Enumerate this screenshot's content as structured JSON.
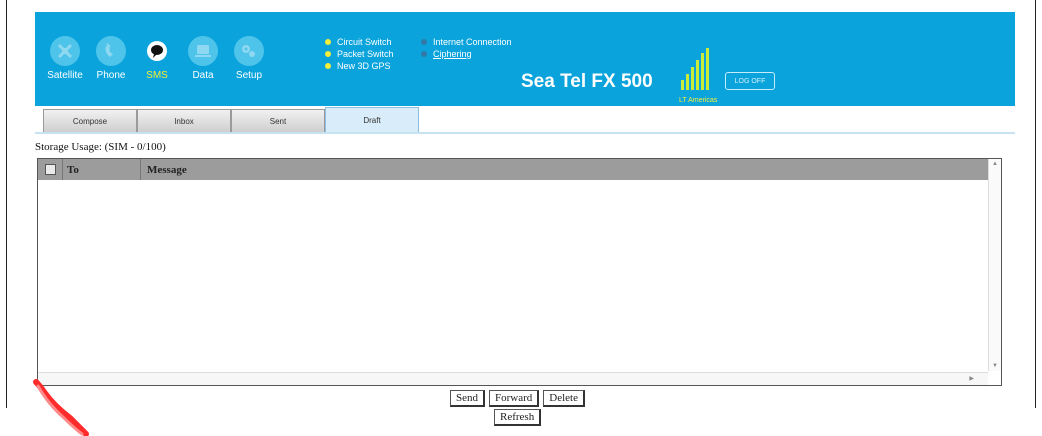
{
  "header": {
    "nav": [
      {
        "label": "Satellite",
        "icon": "satellite-icon"
      },
      {
        "label": "Phone",
        "icon": "phone-icon"
      },
      {
        "label": "SMS",
        "icon": "sms-icon",
        "active": true
      },
      {
        "label": "Data",
        "icon": "data-icon"
      },
      {
        "label": "Setup",
        "icon": "setup-icon"
      }
    ],
    "status_col1": [
      "Circuit Switch",
      "Packet Switch",
      "New 3D GPS"
    ],
    "status_col2": {
      "internet": "Internet Connection",
      "ciphering": "Ciphering"
    },
    "brand": "Sea Tel FX 500",
    "signal_label": "LT Americas",
    "logoff": "LOG OFF",
    "bg_color": "#0aa3dc",
    "accent_color": "#f4ee38"
  },
  "tabs": [
    {
      "label": "Compose"
    },
    {
      "label": "Inbox"
    },
    {
      "label": "Sent"
    },
    {
      "label": "Draft",
      "active": true
    }
  ],
  "storage": "Storage Usage: (SIM - 0/100)",
  "table": {
    "columns": [
      "To",
      "Message"
    ],
    "rows": []
  },
  "buttons": {
    "send": "Send",
    "forward": "Forward",
    "delete": "Delete",
    "refresh": "Refresh"
  }
}
